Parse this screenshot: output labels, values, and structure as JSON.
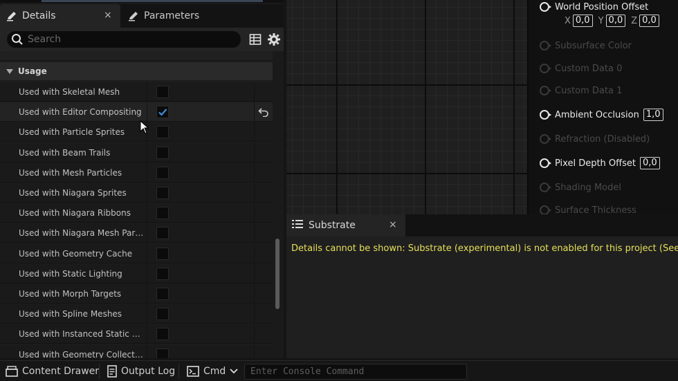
{
  "details_tabs": {
    "details_label": "Details",
    "details_close": "×",
    "parameters_label": "Parameters"
  },
  "search": {
    "placeholder": "Search"
  },
  "usage_section": {
    "title": "Usage",
    "properties": [
      {
        "label": "Used with Skeletal Mesh",
        "checked": false
      },
      {
        "label": "Used with Editor Compositing",
        "checked": true,
        "modified": true
      },
      {
        "label": "Used with Particle Sprites",
        "checked": false
      },
      {
        "label": "Used with Beam Trails",
        "checked": false
      },
      {
        "label": "Used with Mesh Particles",
        "checked": false
      },
      {
        "label": "Used with Niagara Sprites",
        "checked": false
      },
      {
        "label": "Used with Niagara Ribbons",
        "checked": false
      },
      {
        "label": "Used with Niagara Mesh Particles",
        "checked": false
      },
      {
        "label": "Used with Geometry Cache",
        "checked": false
      },
      {
        "label": "Used with Static Lighting",
        "checked": false
      },
      {
        "label": "Used with Morph Targets",
        "checked": false
      },
      {
        "label": "Used with Spline Meshes",
        "checked": false
      },
      {
        "label": "Used with Instanced Static Mes…",
        "checked": false
      },
      {
        "label": "Used with Geometry Collections",
        "checked": false
      }
    ]
  },
  "material_node": {
    "world_position_offset": {
      "label": "World Position Offset",
      "x_axis": "X",
      "x": "0,0",
      "y_axis": "Y",
      "y": "0,0",
      "z_axis": "Z",
      "z": "0,0"
    },
    "pins": [
      {
        "label": "Subsurface Color",
        "enabled": false
      },
      {
        "label": "Custom Data 0",
        "enabled": false
      },
      {
        "label": "Custom Data 1",
        "enabled": false
      },
      {
        "label": "Ambient Occlusion",
        "enabled": true,
        "value": "1,0"
      },
      {
        "label": "Refraction (Disabled)",
        "enabled": false
      },
      {
        "label": "Pixel Depth Offset",
        "enabled": true,
        "value": "0,0"
      },
      {
        "label": "Shading Model",
        "enabled": false
      },
      {
        "label": "Surface Thickness",
        "enabled": false
      }
    ]
  },
  "substrate_panel": {
    "tab_label": "Substrate",
    "close": "×",
    "message": "Details cannot be shown: Substrate (experimental) is not enabled for this project (See the p"
  },
  "bottom_bar": {
    "content_drawer": "Content Drawer",
    "output_log": "Output Log",
    "cmd": "Cmd",
    "console_placeholder": "Enter Console Command"
  },
  "colors": {
    "panel_bg": "#1a1a1a",
    "graph_bg": "#1f1f1f",
    "checkbox_check": "#3b8de0",
    "warning_text": "#e6e05a"
  }
}
